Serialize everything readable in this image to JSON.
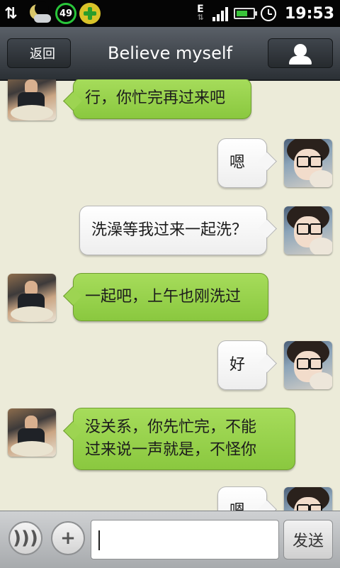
{
  "status_bar": {
    "badge_number": "49",
    "network": "E",
    "time": "19:53",
    "battery_level": 0.7
  },
  "header": {
    "back_label": "返回",
    "title": "Believe myself",
    "profile_icon": "person-icon"
  },
  "messages": [
    {
      "sender": "other",
      "text": "行，你忙完再过来吧"
    },
    {
      "sender": "me",
      "text": "嗯"
    },
    {
      "sender": "me",
      "text": "洗澡等我过来一起洗？"
    },
    {
      "sender": "other",
      "text": "一起吧，上午也刚洗过"
    },
    {
      "sender": "me",
      "text": "好"
    },
    {
      "sender": "other",
      "lines": [
        "没关系，你先忙完，不能",
        "过来说一声就是，不怪你"
      ]
    },
    {
      "sender": "me",
      "text": "嗯"
    }
  ],
  "input_bar": {
    "voice_icon": "voice-icon",
    "plus_icon": "plus-icon",
    "input_value": "",
    "send_label": "发送"
  },
  "colors": {
    "background": "#ecebd9",
    "incoming_bubble": "#9dd452",
    "outgoing_bubble": "#f6f6f6",
    "header": "#2b3035"
  }
}
